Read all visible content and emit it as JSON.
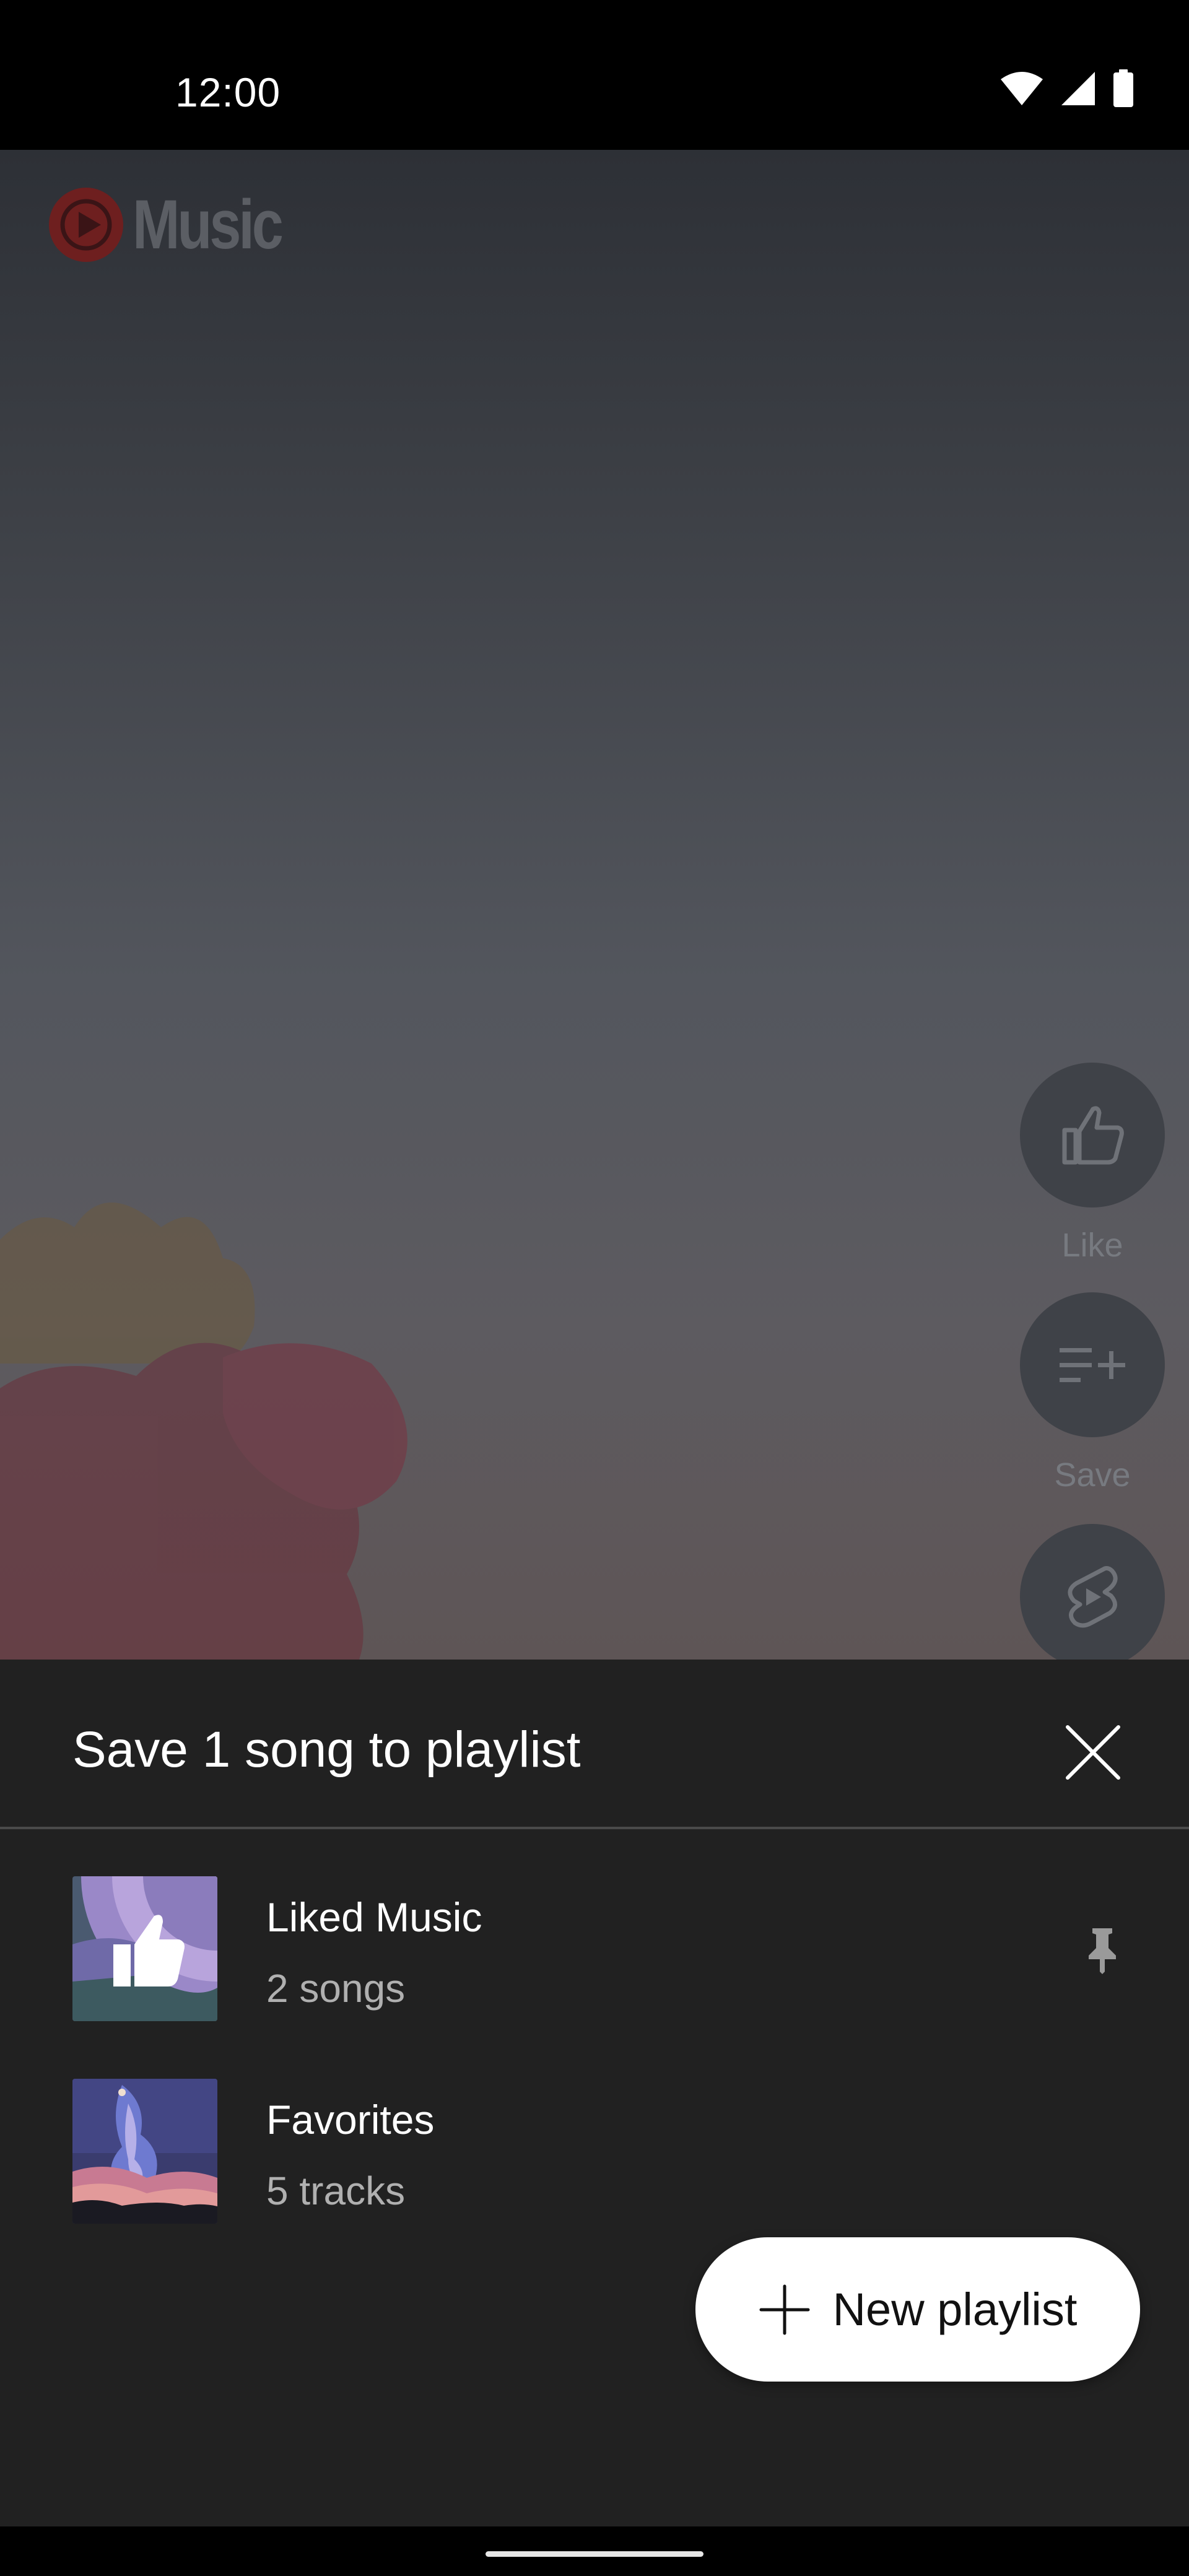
{
  "status_bar": {
    "time": "12:00",
    "icons": [
      "wifi-icon",
      "signal-icon",
      "battery-icon"
    ]
  },
  "player": {
    "logo_text": "Music",
    "logo_color": "#c4302b",
    "actions": [
      {
        "icon": "thumb-up-icon",
        "label": "Like"
      },
      {
        "icon": "playlist-add-icon",
        "label": "Save"
      },
      {
        "icon": "shorts-icon",
        "label": ""
      }
    ]
  },
  "sheet": {
    "title": "Save 1 song to playlist",
    "close_icon": "close-icon",
    "playlists": [
      {
        "name": "Liked Music",
        "count": "2 songs",
        "pinned": true,
        "thumb": "liked-music-art"
      },
      {
        "name": "Favorites",
        "count": "5 tracks",
        "pinned": false,
        "thumb": "favorites-art"
      }
    ],
    "new_playlist_label": "New playlist"
  },
  "colors": {
    "sheet_background": "#212121",
    "button_background": "#ffffff"
  }
}
